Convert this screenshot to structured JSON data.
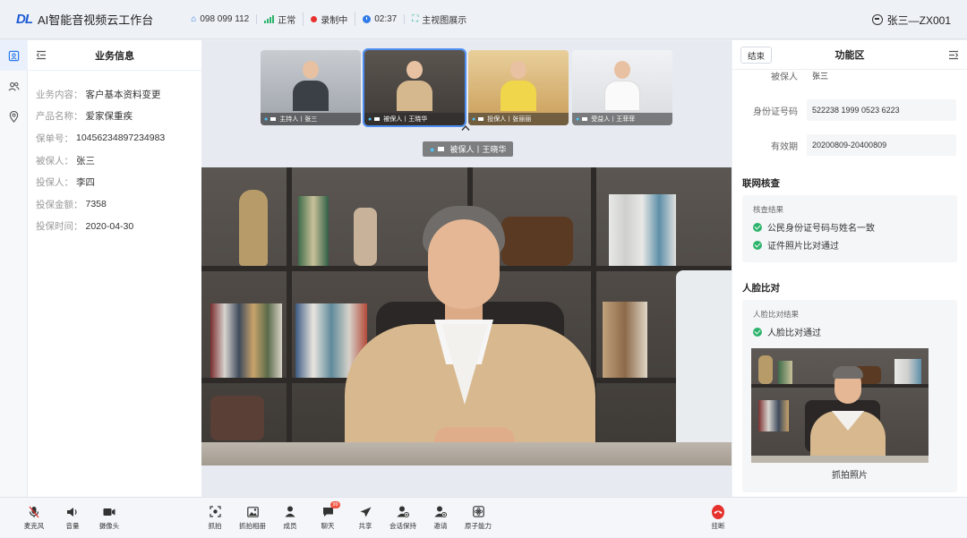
{
  "header": {
    "logo": "DL",
    "app_title": "AI智能音视频云工作台",
    "status": {
      "phone": "098 099 112",
      "network": "正常",
      "recording": "录制中",
      "timer": "02:37",
      "view_mode": "主视图展示"
    },
    "user": "张三—ZX001"
  },
  "business_info": {
    "title": "业务信息",
    "rows": [
      {
        "key": "业务内容：",
        "value": "客户基本资料变更"
      },
      {
        "key": "产品名称：",
        "value": "爱家保重疾"
      },
      {
        "key": "保单号：",
        "value": "10456234897234983"
      },
      {
        "key": "被保人：",
        "value": "张三"
      },
      {
        "key": "投保人：",
        "value": "李四"
      },
      {
        "key": "投保金额：",
        "value": "7358"
      },
      {
        "key": "投保时间：",
        "value": "2020-04-30"
      }
    ]
  },
  "video": {
    "thumbnails": [
      {
        "label": "主持人丨张三"
      },
      {
        "label": "被保人丨王晓华"
      },
      {
        "label": "投保人丨张丽丽"
      },
      {
        "label": "受益人丨王菲菲"
      }
    ],
    "main_label": "被保人丨王晓华"
  },
  "function_panel": {
    "end_button": "结束",
    "title": "功能区",
    "fields": [
      {
        "key": "被保人",
        "value": "张三"
      },
      {
        "key": "身份证号码",
        "value": "522238 1999 0523 6223"
      },
      {
        "key": "有效期",
        "value": "20200809-20400809"
      }
    ],
    "network_check": {
      "title": "联网核查",
      "caption": "核查结果",
      "results": [
        "公民身份证号码与姓名一致",
        "证件照片比对通过"
      ]
    },
    "face_compare": {
      "title": "人脸比对",
      "caption": "人脸比对结果",
      "results": [
        "人脸比对通过"
      ],
      "photo_caption": "抓拍照片"
    }
  },
  "toolbar": {
    "left": [
      {
        "label": "麦克风",
        "icon": "mic-muted-icon"
      },
      {
        "label": "音量",
        "icon": "volume-icon"
      },
      {
        "label": "摄像头",
        "icon": "camera-icon"
      }
    ],
    "center": [
      {
        "label": "抓拍",
        "icon": "capture-icon"
      },
      {
        "label": "抓拍相册",
        "icon": "album-icon"
      },
      {
        "label": "成员",
        "icon": "members-icon"
      },
      {
        "label": "聊天",
        "icon": "chat-icon",
        "badge": "99"
      },
      {
        "label": "共享",
        "icon": "share-icon"
      },
      {
        "label": "会话保持",
        "icon": "hold-icon"
      },
      {
        "label": "邀请",
        "icon": "invite-icon"
      },
      {
        "label": "原子能力",
        "icon": "atomic-icon"
      }
    ],
    "hangup": {
      "label": "挂断",
      "icon": "hangup-icon"
    }
  },
  "colors": {
    "accent": "#2f7bea",
    "success": "#2db36b",
    "danger": "#e6322f"
  }
}
